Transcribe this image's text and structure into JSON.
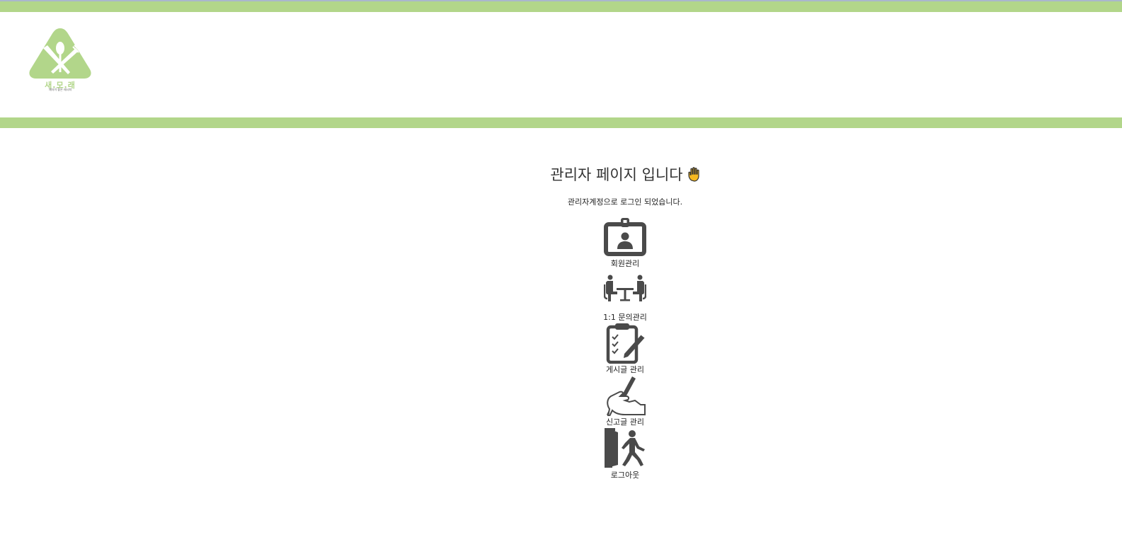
{
  "logo": {
    "name": "새.모.래",
    "tagline": "채식이 좋은 레시피",
    "icon": "fork-spoon-knife-logo",
    "color": "#b2d68a"
  },
  "colors": {
    "accent_green": "#b2d68a",
    "icon_gray": "#4a4a4a",
    "hand_yellow": "#f5b820"
  },
  "page": {
    "title": "관리자 페이지 입니다",
    "title_icon": "raised-hand-icon",
    "subtitle": "관리자계정으로 로그인 되었습니다."
  },
  "menu": [
    {
      "label": "회원관리",
      "icon": "id-badge-icon"
    },
    {
      "label": "1:1 문의관리",
      "icon": "consultation-meeting-icon"
    },
    {
      "label": "게시글 관리",
      "icon": "clipboard-checklist-icon"
    },
    {
      "label": "신고글 관리",
      "icon": "hand-writing-icon"
    },
    {
      "label": "로그아웃",
      "icon": "exit-door-icon"
    }
  ]
}
